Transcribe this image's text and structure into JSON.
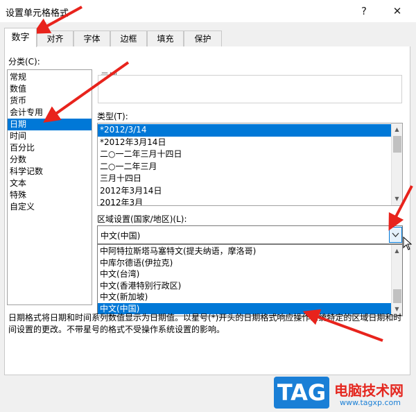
{
  "window": {
    "title": "设置单元格格式",
    "help_label": "?",
    "close_label": "✕"
  },
  "tabs": [
    {
      "label": "数字",
      "active": true
    },
    {
      "label": "对齐"
    },
    {
      "label": "字体"
    },
    {
      "label": "边框"
    },
    {
      "label": "填充"
    },
    {
      "label": "保护"
    }
  ],
  "category": {
    "label": "分类(C):",
    "items": [
      "常规",
      "数值",
      "货币",
      "会计专用",
      "日期",
      "时间",
      "百分比",
      "分数",
      "科学记数",
      "文本",
      "特殊",
      "自定义"
    ],
    "selected": "日期"
  },
  "sample": {
    "label": "示例"
  },
  "type": {
    "label": "类型(T):",
    "items": [
      "*2012/3/14",
      "*2012年3月14日",
      "二○一二年三月十四日",
      "二○一二年三月",
      "三月十四日",
      "2012年3月14日",
      "2012年3月"
    ],
    "selected": "*2012/3/14"
  },
  "locale": {
    "label": "区域设置(国家/地区)(L):",
    "value": "中文(中国)",
    "dropdown_icon": "chevron-down-icon",
    "options": [
      "中阿特拉斯塔马塞特文(提夫纳语，摩洛哥)",
      "中库尔德语(伊拉克)",
      "中文(台湾)",
      "中文(香港特别行政区)",
      "中文(新加坡)",
      "中文(中国)"
    ],
    "selected_option": "中文(中国)"
  },
  "description": {
    "line1": "日期格式将日期和时间系列数值显示为日期值。以星号(*)开头的日期格式响应操作系统特定的区域日期和时",
    "line2": "间设置的更改。不带星号的格式不受操作系统设置的影响。"
  },
  "watermark": {
    "badge": "TAG",
    "title": "电脑技术网",
    "url": "www.tagxp.com"
  },
  "colors": {
    "selection": "#0078d7",
    "annotation_arrow": "#e8231c",
    "logo_blue": "#1a7fd6"
  }
}
